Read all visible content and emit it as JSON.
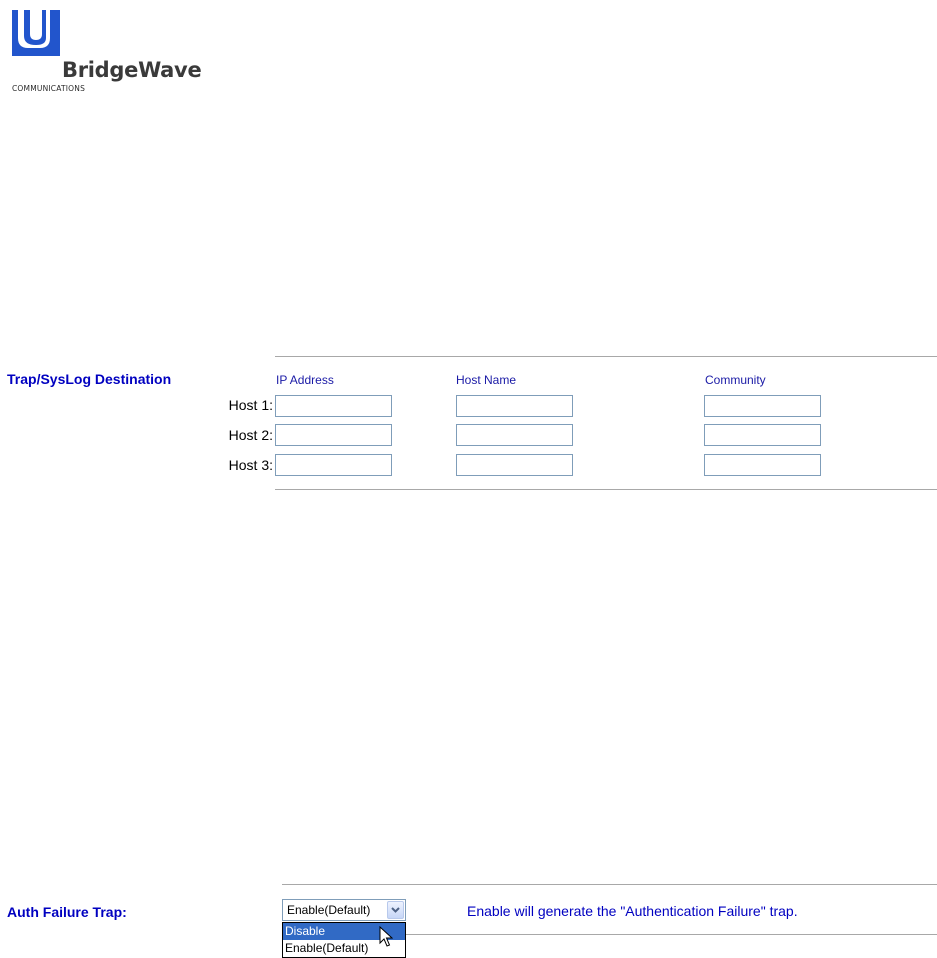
{
  "logo": {
    "company": "BridgeWave",
    "tagline": "COMMUNICATIONS",
    "color": "#2255cc"
  },
  "trap_destination": {
    "section_label": "Trap/SysLog Destination",
    "columns": [
      "IP Address",
      "Host Name",
      "Community"
    ],
    "hosts": [
      {
        "label": "Host 1:",
        "ip": "",
        "hostname": "",
        "community": ""
      },
      {
        "label": "Host 2:",
        "ip": "",
        "hostname": "",
        "community": ""
      },
      {
        "label": "Host 3:",
        "ip": "",
        "hostname": "",
        "community": ""
      }
    ]
  },
  "auth_failure": {
    "section_label": "Auth Failure Trap:",
    "selected_value": "Enable(Default)",
    "options": [
      "Disable",
      "Enable(Default)"
    ],
    "highlighted_option": "Disable",
    "hint": "Enable will generate the \"Authentication Failure\" trap."
  },
  "colors": {
    "label_blue": "#0000c0",
    "selection_blue": "#316ac5"
  }
}
